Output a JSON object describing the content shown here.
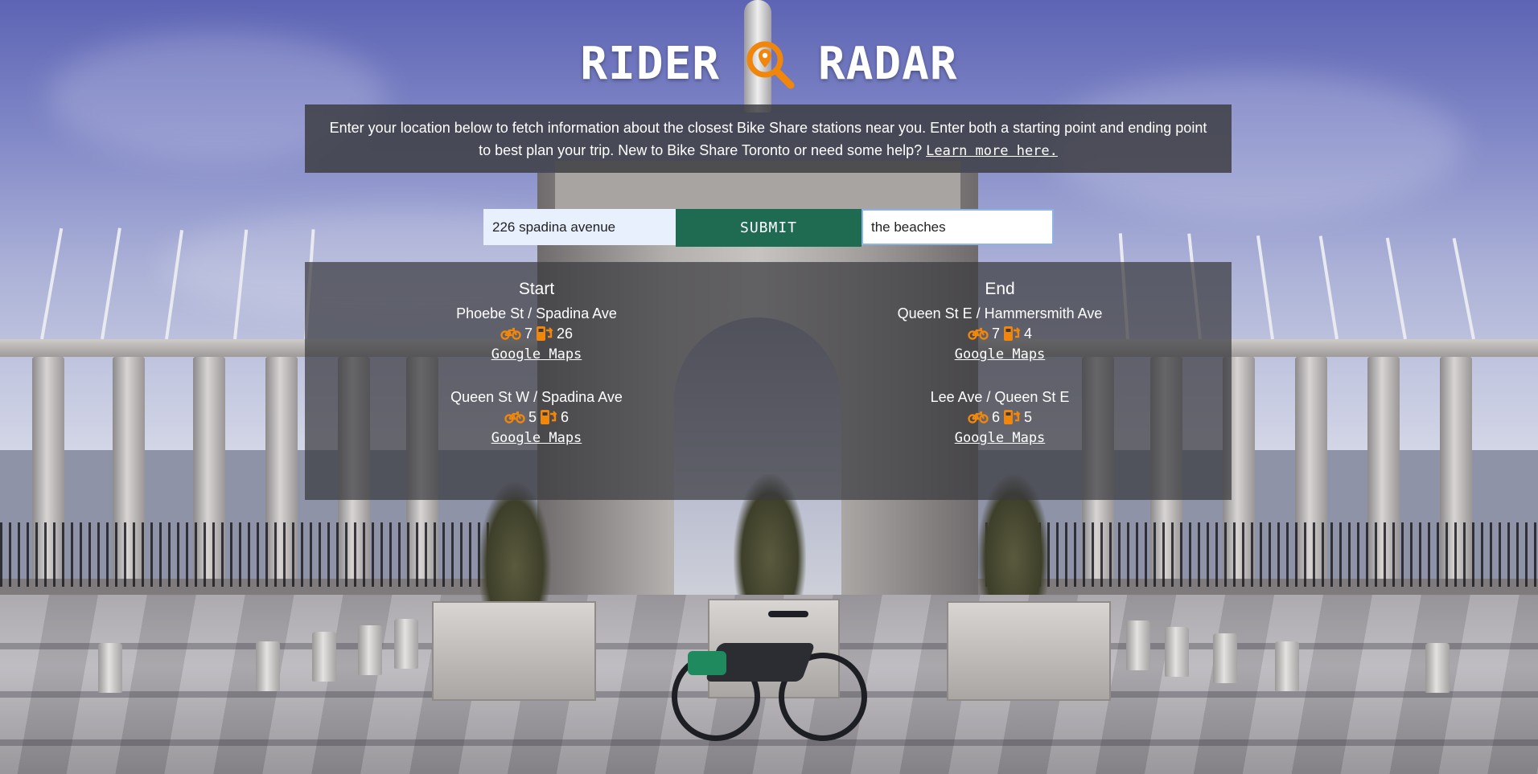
{
  "app": {
    "title_left": "RIDER",
    "title_right": "RADAR",
    "accent_color": "#f0860c",
    "button_color": "#1e6b51"
  },
  "intro": {
    "text": "Enter your location below to fetch information about the closest Bike Share stations near you. Enter both a starting point and ending point to best plan your trip. New to Bike Share Toronto or need some help?",
    "link_label": "Learn more here."
  },
  "search": {
    "start_value": "226 spadina avenue",
    "submit_label": "SUBMIT",
    "end_value": "the beaches"
  },
  "results": {
    "start": {
      "heading": "Start",
      "stations": [
        {
          "name": "Phoebe St / Spadina Ave",
          "bikes": "7",
          "docks": "26",
          "link": "Google Maps"
        },
        {
          "name": "Queen St W / Spadina Ave",
          "bikes": "5",
          "docks": "6",
          "link": "Google Maps"
        }
      ]
    },
    "end": {
      "heading": "End",
      "stations": [
        {
          "name": "Queen St E / Hammersmith Ave",
          "bikes": "7",
          "docks": "4",
          "link": "Google Maps"
        },
        {
          "name": "Lee Ave / Queen St E",
          "bikes": "6",
          "docks": "5",
          "link": "Google Maps"
        }
      ]
    }
  },
  "icons": {
    "logo": "magnifier-pin-icon",
    "bikes": "bicycle-icon",
    "docks": "dock-station-icon"
  }
}
